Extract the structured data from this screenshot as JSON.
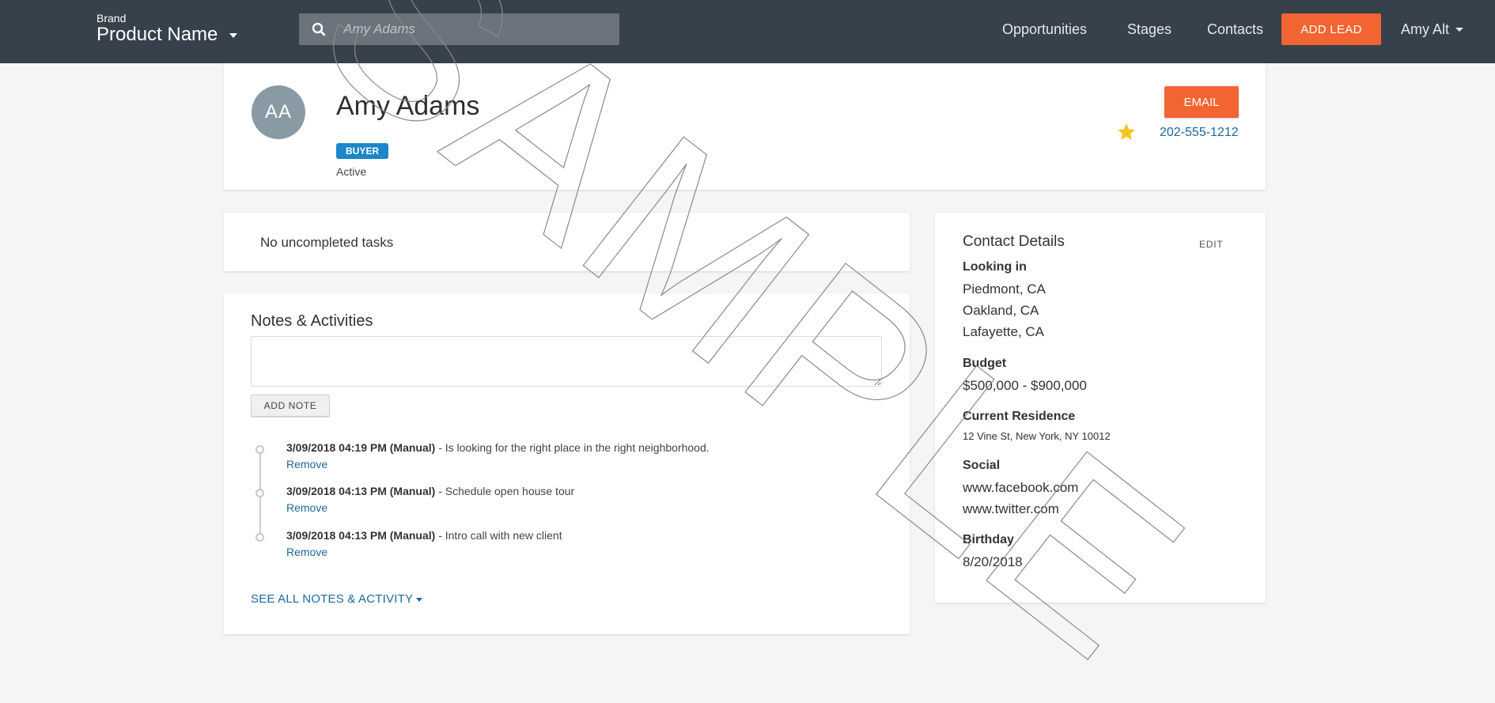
{
  "header": {
    "brand_small": "Brand",
    "product_name": "Product Name",
    "search_placeholder": "Amy Adams",
    "nav": [
      "Opportunities",
      "Stages",
      "Contacts"
    ],
    "add_lead_label": "ADD LEAD",
    "user_name": "Amy Alt"
  },
  "profile": {
    "initials": "AA",
    "name": "Amy Adams",
    "role": "BUYER",
    "status": "Active",
    "email_label": "EMAIL",
    "phone": "202-555-1212",
    "starred": true
  },
  "tasks": {
    "empty_text": "No uncompleted tasks"
  },
  "notes": {
    "title": "Notes & Activities",
    "add_note_label": "ADD NOTE",
    "items": [
      {
        "date": "3/09/2018 04:19 PM (Manual)",
        "text": " - Is looking for the right place in the right neighborhood.",
        "remove": "Remove"
      },
      {
        "date": "3/09/2018 04:13 PM (Manual)",
        "text": " - Schedule open house tour",
        "remove": "Remove"
      },
      {
        "date": "3/09/2018 04:13 PM (Manual)",
        "text": " - Intro call with new client",
        "remove": "Remove"
      }
    ],
    "see_all_label": "SEE ALL NOTES & ACTIVITY"
  },
  "contact_details": {
    "title": "Contact Details",
    "edit_label": "EDIT",
    "looking_in_label": "Looking in",
    "looking_in": [
      "Piedmont, CA",
      "Oakland, CA",
      "Lafayette, CA"
    ],
    "budget_label": "Budget",
    "budget": "$500,000 - $900,000",
    "residence_label": "Current Residence",
    "residence": "12 Vine St, New York, NY 10012",
    "social_label": "Social",
    "social": [
      "www.facebook.com",
      "www.twitter.com"
    ],
    "birthday_label": "Birthday",
    "birthday": "8/20/2018"
  },
  "watermark": {
    "text": "SAMPLE"
  },
  "colors": {
    "topbar": "#37414b",
    "accent": "#f26432",
    "badge": "#1b86c8",
    "link": "#1b6a9c",
    "star": "#f3c623"
  }
}
